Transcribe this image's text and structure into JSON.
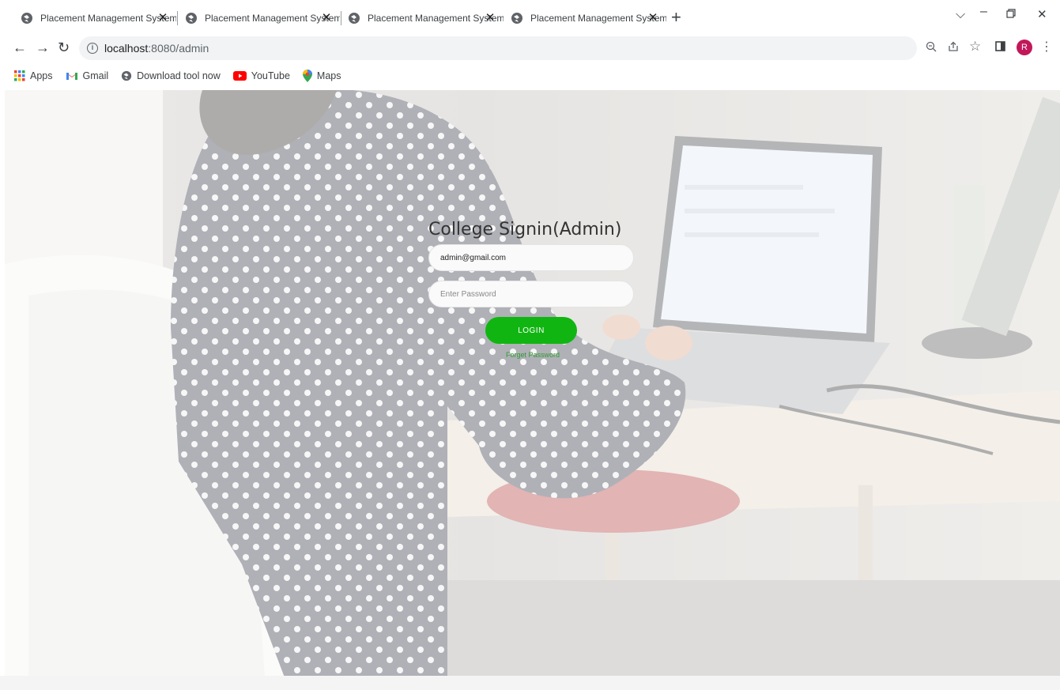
{
  "browser": {
    "tabs": [
      {
        "title": "Placement Management System",
        "active": false
      },
      {
        "title": "Placement Management System",
        "active": false
      },
      {
        "title": "Placement Management System",
        "active": false
      },
      {
        "title": "Placement Management System",
        "active": true
      }
    ],
    "new_tab_icon": "plus-icon",
    "window_controls": [
      "chevron-down-icon",
      "minimize-icon",
      "restore-icon",
      "close-icon"
    ],
    "url_host": "localhost",
    "url_rest": ":8080/admin",
    "profile_initial": "R",
    "profile_color": "#c2185b"
  },
  "bookmarks": [
    {
      "label": "Apps",
      "icon": "apps-grid-icon"
    },
    {
      "label": "Gmail",
      "icon": "gmail-icon"
    },
    {
      "label": "Download tool now",
      "icon": "globe-icon"
    },
    {
      "label": "YouTube",
      "icon": "youtube-icon"
    },
    {
      "label": "Maps",
      "icon": "maps-pin-icon"
    }
  ],
  "login": {
    "title": "College Signin(Admin)",
    "email_value": "admin@gmail.com",
    "password_placeholder": "Enter Password",
    "login_button": "LOGIN",
    "forget_link": "Forget Password",
    "accent": "#11b512"
  }
}
